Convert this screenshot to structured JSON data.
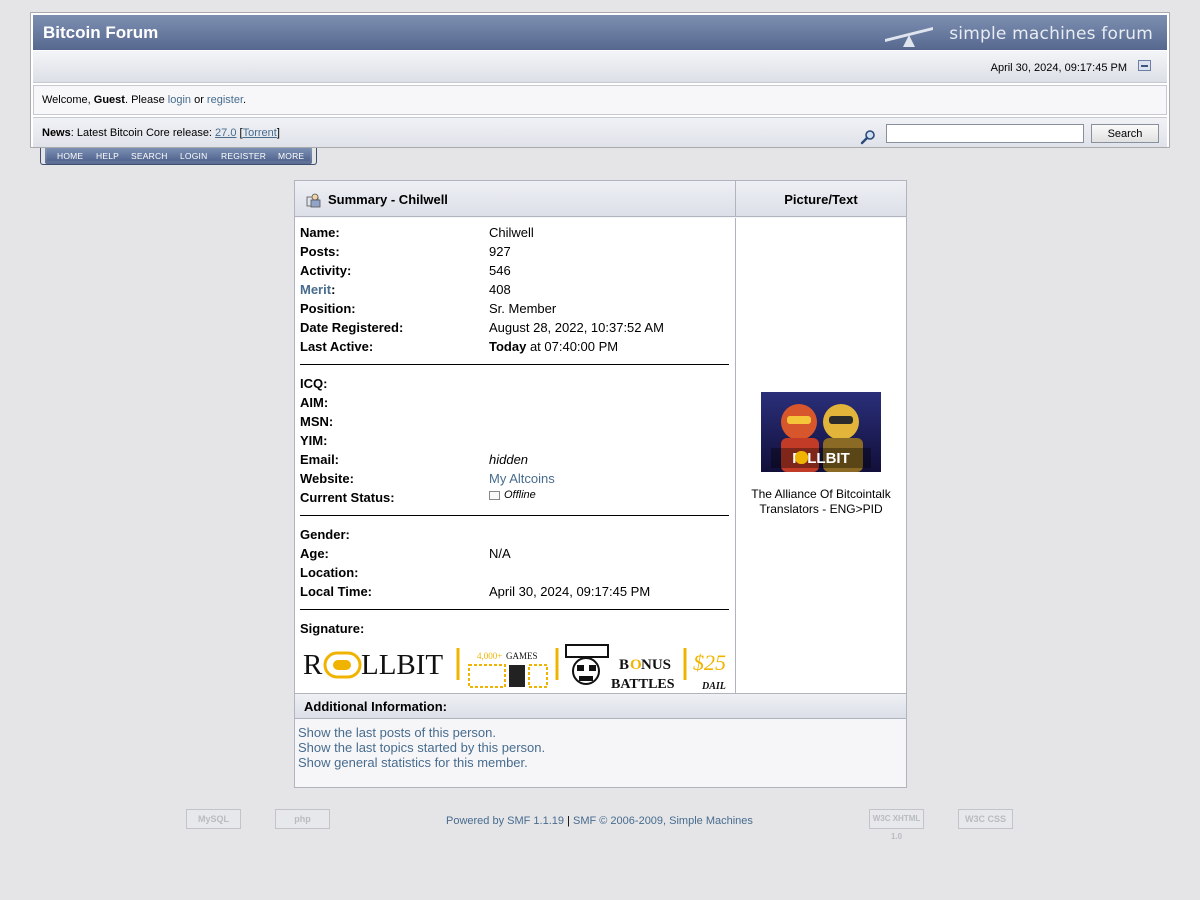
{
  "header": {
    "forum_title": "Bitcoin Forum",
    "logo_text": "simple machines forum",
    "date": "April 30, 2024, 09:17:45 PM"
  },
  "welcome": {
    "prefix": "Welcome, ",
    "guest": "Guest",
    "middle": ". Please ",
    "login": "login",
    "or": " or ",
    "register": "register",
    "suffix": "."
  },
  "news": {
    "label": "News",
    "text": ": Latest Bitcoin Core release: ",
    "version": "27.0",
    "torrent": "Torrent"
  },
  "search": {
    "placeholder": "",
    "button": "Search"
  },
  "menu": [
    "HOME",
    "HELP",
    "SEARCH",
    "LOGIN",
    "REGISTER",
    "MORE"
  ],
  "profile": {
    "summary_title": "Summary - Chilwell",
    "picture_title": "Picture/Text",
    "fields": [
      {
        "label": "Name:",
        "value": "Chilwell"
      },
      {
        "label": "Posts:",
        "value": "927"
      },
      {
        "label": "Activity:",
        "value": "546"
      },
      {
        "label": "Merit",
        "value": "408"
      },
      {
        "label": "Position:",
        "value": "Sr. Member"
      },
      {
        "label": "Date Registered:",
        "value": "August 28, 2022, 10:37:52 AM"
      },
      {
        "label": "Last Active:",
        "value_bold": "Today",
        "value": " at 07:40:00 PM"
      }
    ],
    "contact": [
      {
        "label": "ICQ:",
        "value": ""
      },
      {
        "label": "AIM:",
        "value": ""
      },
      {
        "label": "MSN:",
        "value": ""
      },
      {
        "label": "YIM:",
        "value": ""
      },
      {
        "label": "Email:",
        "value": "hidden"
      },
      {
        "label": "Website:",
        "value": "My Altcoins"
      },
      {
        "label": "Current Status:",
        "value": "Offline"
      }
    ],
    "personal": [
      {
        "label": "Gender:",
        "value": ""
      },
      {
        "label": "Age:",
        "value": "N/A"
      },
      {
        "label": "Location:",
        "value": ""
      },
      {
        "label": "Local Time:",
        "value": "April 30, 2024, 09:17:45 PM"
      }
    ],
    "signature_label": "Signature:",
    "signature": {
      "brand_r": "R",
      "brand_rest": "LLBIT",
      "games_count": "4,000+",
      "games": "GAMES",
      "bonus_b": "B",
      "bonus_o": "O",
      "bonus_nus": "NUS",
      "battles": "BATTLES",
      "money": "$25",
      "daily": "DAIL"
    },
    "avatar_brand": "R  LLBIT",
    "avatar_caption": "The Alliance Of Bitcointalk Translators - ENG>PID"
  },
  "additional": {
    "title": "Additional Information:",
    "links": [
      "Show the last posts of this person.",
      "Show the last topics started by this person.",
      "Show general statistics for this member."
    ]
  },
  "footer": {
    "powered": "Powered by SMF 1.1.19",
    "sep": " | ",
    "copyright": "SMF © 2006-2009, Simple Machines",
    "badge_mysql": "MySQL",
    "badge_php": "php",
    "badge_xhtml": "W3C XHTML 1.0",
    "badge_css": "W3C CSS"
  },
  "colors": {
    "link": "#476c8e",
    "title_bar": "#56688f",
    "sig_gold": "#f0b400"
  }
}
